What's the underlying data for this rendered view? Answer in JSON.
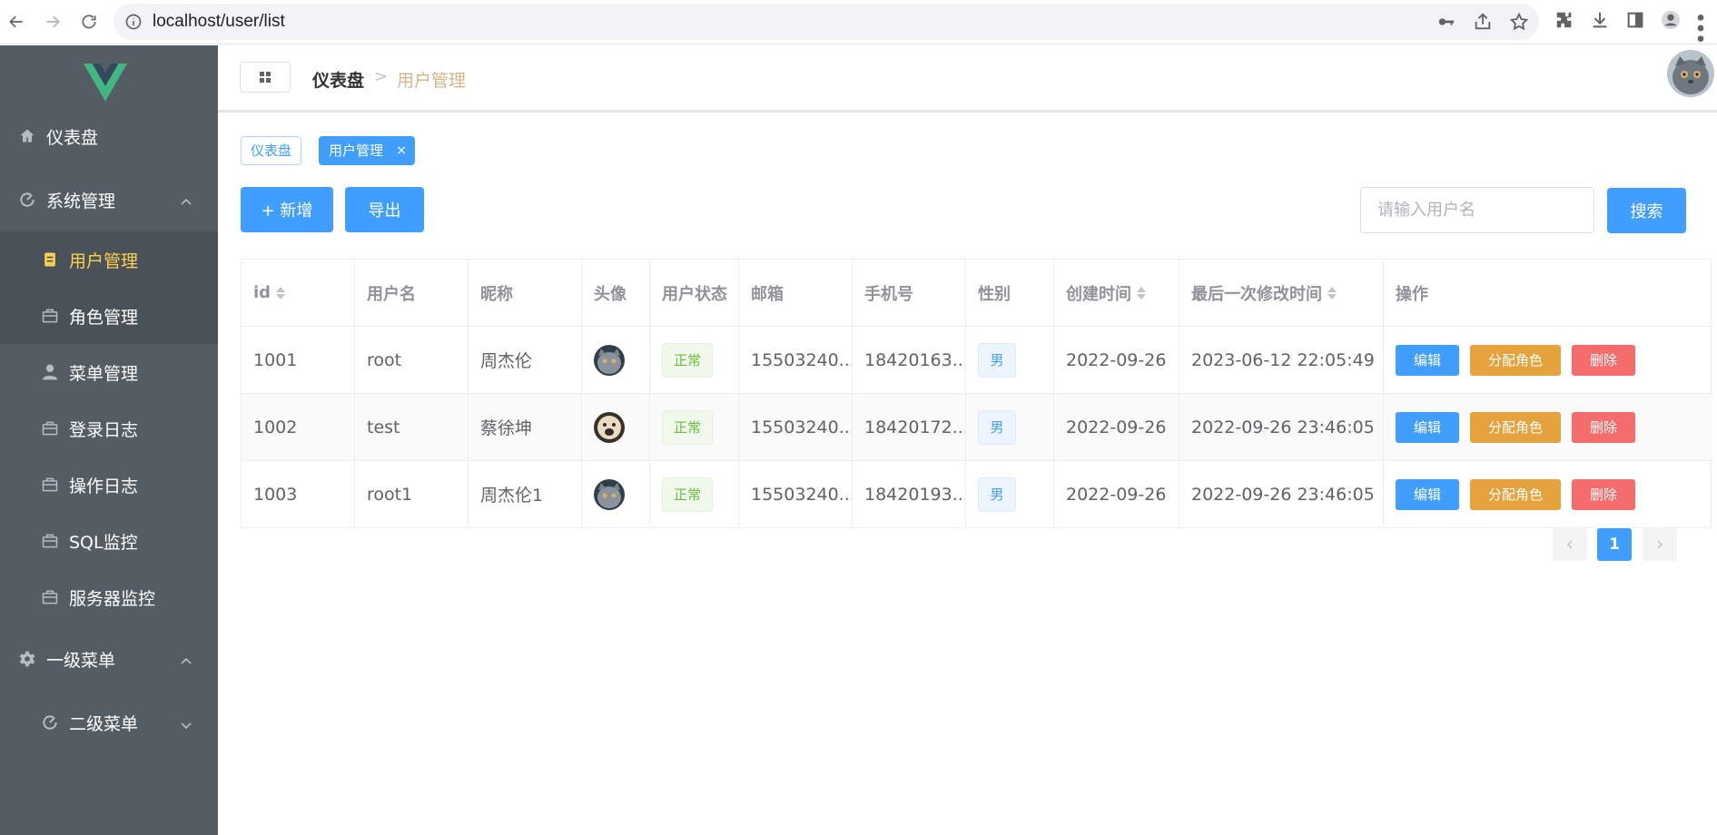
{
  "browser": {
    "url": "localhost/user/list"
  },
  "sidebar": {
    "items": [
      {
        "label": "仪表盘",
        "icon": "home-icon"
      },
      {
        "label": "系统管理",
        "icon": "refresh-icon"
      },
      {
        "label": "用户管理",
        "icon": "document-icon"
      },
      {
        "label": "角色管理",
        "icon": "suitcase-icon"
      },
      {
        "label": "菜单管理",
        "icon": "user-icon"
      },
      {
        "label": "登录日志",
        "icon": "suitcase-icon"
      },
      {
        "label": "操作日志",
        "icon": "suitcase-icon"
      },
      {
        "label": "SQL监控",
        "icon": "suitcase-icon"
      },
      {
        "label": "服务器监控",
        "icon": "suitcase-icon"
      },
      {
        "label": "一级菜单",
        "icon": "gear-icon"
      },
      {
        "label": "二级菜单",
        "icon": "refresh-icon"
      }
    ]
  },
  "header": {
    "breadcrumb_home": "仪表盘",
    "breadcrumb_sep": ">",
    "breadcrumb_current": "用户管理"
  },
  "tags": {
    "plain": "仪表盘",
    "active": "用户管理",
    "close": "×"
  },
  "toolbar": {
    "add_label": "+ 新增",
    "export_label": "导出",
    "search_placeholder": "请输入用户名",
    "search_label": "搜索"
  },
  "table": {
    "headers": [
      "id",
      "用户名",
      "昵称",
      "头像",
      "用户状态",
      "邮箱",
      "手机号",
      "性别",
      "创建时间",
      "最后一次修改时间",
      "操作"
    ],
    "rows": [
      {
        "id": "1001",
        "username": "root",
        "nickname": "周杰伦",
        "status": "正常",
        "email": "15503240...",
        "phone": "18420163...",
        "sex": "男",
        "created": "2022-09-26",
        "updated": "2023-06-12 22:05:49"
      },
      {
        "id": "1002",
        "username": "test",
        "nickname": "蔡徐坤",
        "status": "正常",
        "email": "15503240...",
        "phone": "18420172...",
        "sex": "男",
        "created": "2022-09-26",
        "updated": "2022-09-26 23:46:05"
      },
      {
        "id": "1003",
        "username": "root1",
        "nickname": "周杰伦1",
        "status": "正常",
        "email": "15503240...",
        "phone": "18420193...",
        "sex": "男",
        "created": "2022-09-26",
        "updated": "2022-09-26 23:46:05"
      }
    ],
    "ops": {
      "edit": "编辑",
      "assign": "分配角色",
      "delete": "删除"
    }
  },
  "pagination": {
    "current": "1"
  },
  "colors": {
    "sidebar_bg": "#545c64",
    "active_menu": "#ffd04b",
    "primary": "#409eff",
    "warning": "#e6a23c",
    "danger": "#f56c6c",
    "success": "#67c23a"
  }
}
